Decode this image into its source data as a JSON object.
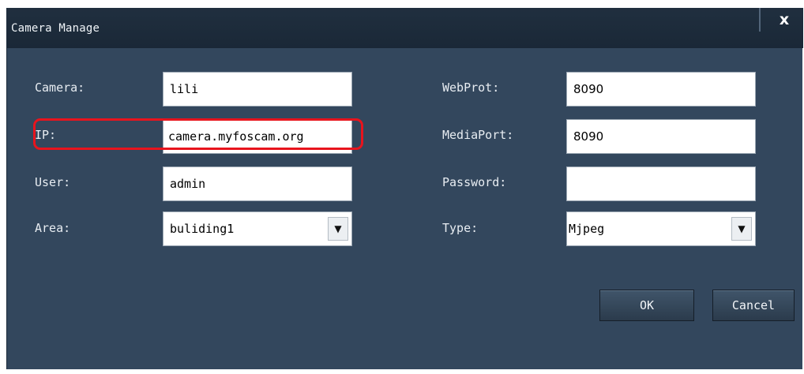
{
  "dialog": {
    "title": "Camera Manage",
    "close_label": "x"
  },
  "form": {
    "camera": {
      "label": "Camera:",
      "value": "lili"
    },
    "ip": {
      "label": "IP:",
      "value": "camera.myfoscam.org"
    },
    "user": {
      "label": "User:",
      "value": "admin"
    },
    "area": {
      "label": "Area:",
      "value": "buliding1"
    },
    "webport": {
      "label": "WebProt:",
      "value": "8090"
    },
    "mediaport": {
      "label": "MediaPort:",
      "value": "8090"
    },
    "password": {
      "label": "Password:",
      "value": ""
    },
    "type": {
      "label": "Type:",
      "value": "Mjpeg"
    }
  },
  "buttons": {
    "ok": "OK",
    "cancel": "Cancel"
  },
  "colors": {
    "dialog_bg": "#33475d",
    "titlebar_bg": "#1d2b3a",
    "highlight": "#e8141d"
  },
  "icons": {
    "close": "close-icon",
    "dropdown": "triangle-down-icon"
  }
}
